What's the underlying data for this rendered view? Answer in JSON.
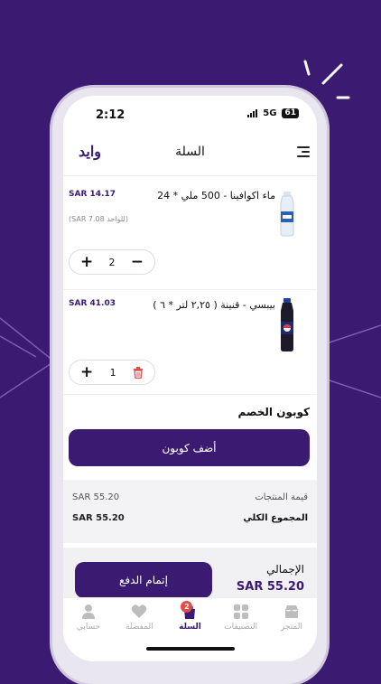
{
  "status": {
    "time": "2:12",
    "network": "5G",
    "battery": "61"
  },
  "header": {
    "logo": "وايد",
    "title": "السلة"
  },
  "cart": {
    "items": [
      {
        "name": "ماء اكوافينا  - 500 ملي * 24",
        "price": "SAR 14.17",
        "unit_price": "(SAR 7.08 للواحد)",
        "quantity": "2"
      },
      {
        "name": "بيبسي  - قنينة ( ٢,٢٥ لتر * ٦ )",
        "price": "SAR 41.03",
        "quantity": "1"
      }
    ]
  },
  "coupon": {
    "title": "كوبون الخصم",
    "button": "أضف كوبون"
  },
  "summary": {
    "products_label": "قيمة المنتجات",
    "products_value": "SAR 55.20",
    "total_label": "المجموع الكلي",
    "total_value": "SAR 55.20"
  },
  "checkout": {
    "grand_label": "الإجمالي",
    "grand_value": "SAR 55.20",
    "pay_button": "إتمام الدفع"
  },
  "tabbar": {
    "store": "المتجر",
    "categories": "التصنيفات",
    "cart": "السلة",
    "cart_badge": "2",
    "favorites": "المفضلة",
    "account": "حسابي"
  },
  "colors": {
    "brand": "#3b1a72",
    "badge": "#e24b4b",
    "pepsi": "#1d2a6b"
  }
}
